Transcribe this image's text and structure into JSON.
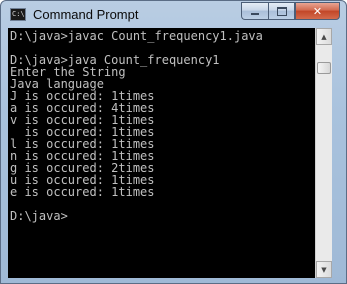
{
  "window": {
    "title": "Command Prompt",
    "app_icon_text": "C:\\",
    "buttons": {
      "minimize": "minimize",
      "maximize": "maximize",
      "close": "✕"
    }
  },
  "console": {
    "lines": [
      "D:\\java>javac Count_frequency1.java",
      "",
      "D:\\java>java Count_frequency1",
      "Enter the String",
      "Java language",
      "J is occured: 1times",
      "a is occured: 4times",
      "v is occured: 1times",
      "  is occured: 1times",
      "l is occured: 1times",
      "n is occured: 1times",
      "g is occured: 2times",
      "u is occured: 1times",
      "e is occured: 1times",
      "",
      "D:\\java>"
    ],
    "text_color": "#c0c0c0",
    "background": "#000000"
  },
  "scrollbar": {
    "up_arrow": "▲",
    "down_arrow": "▼"
  }
}
